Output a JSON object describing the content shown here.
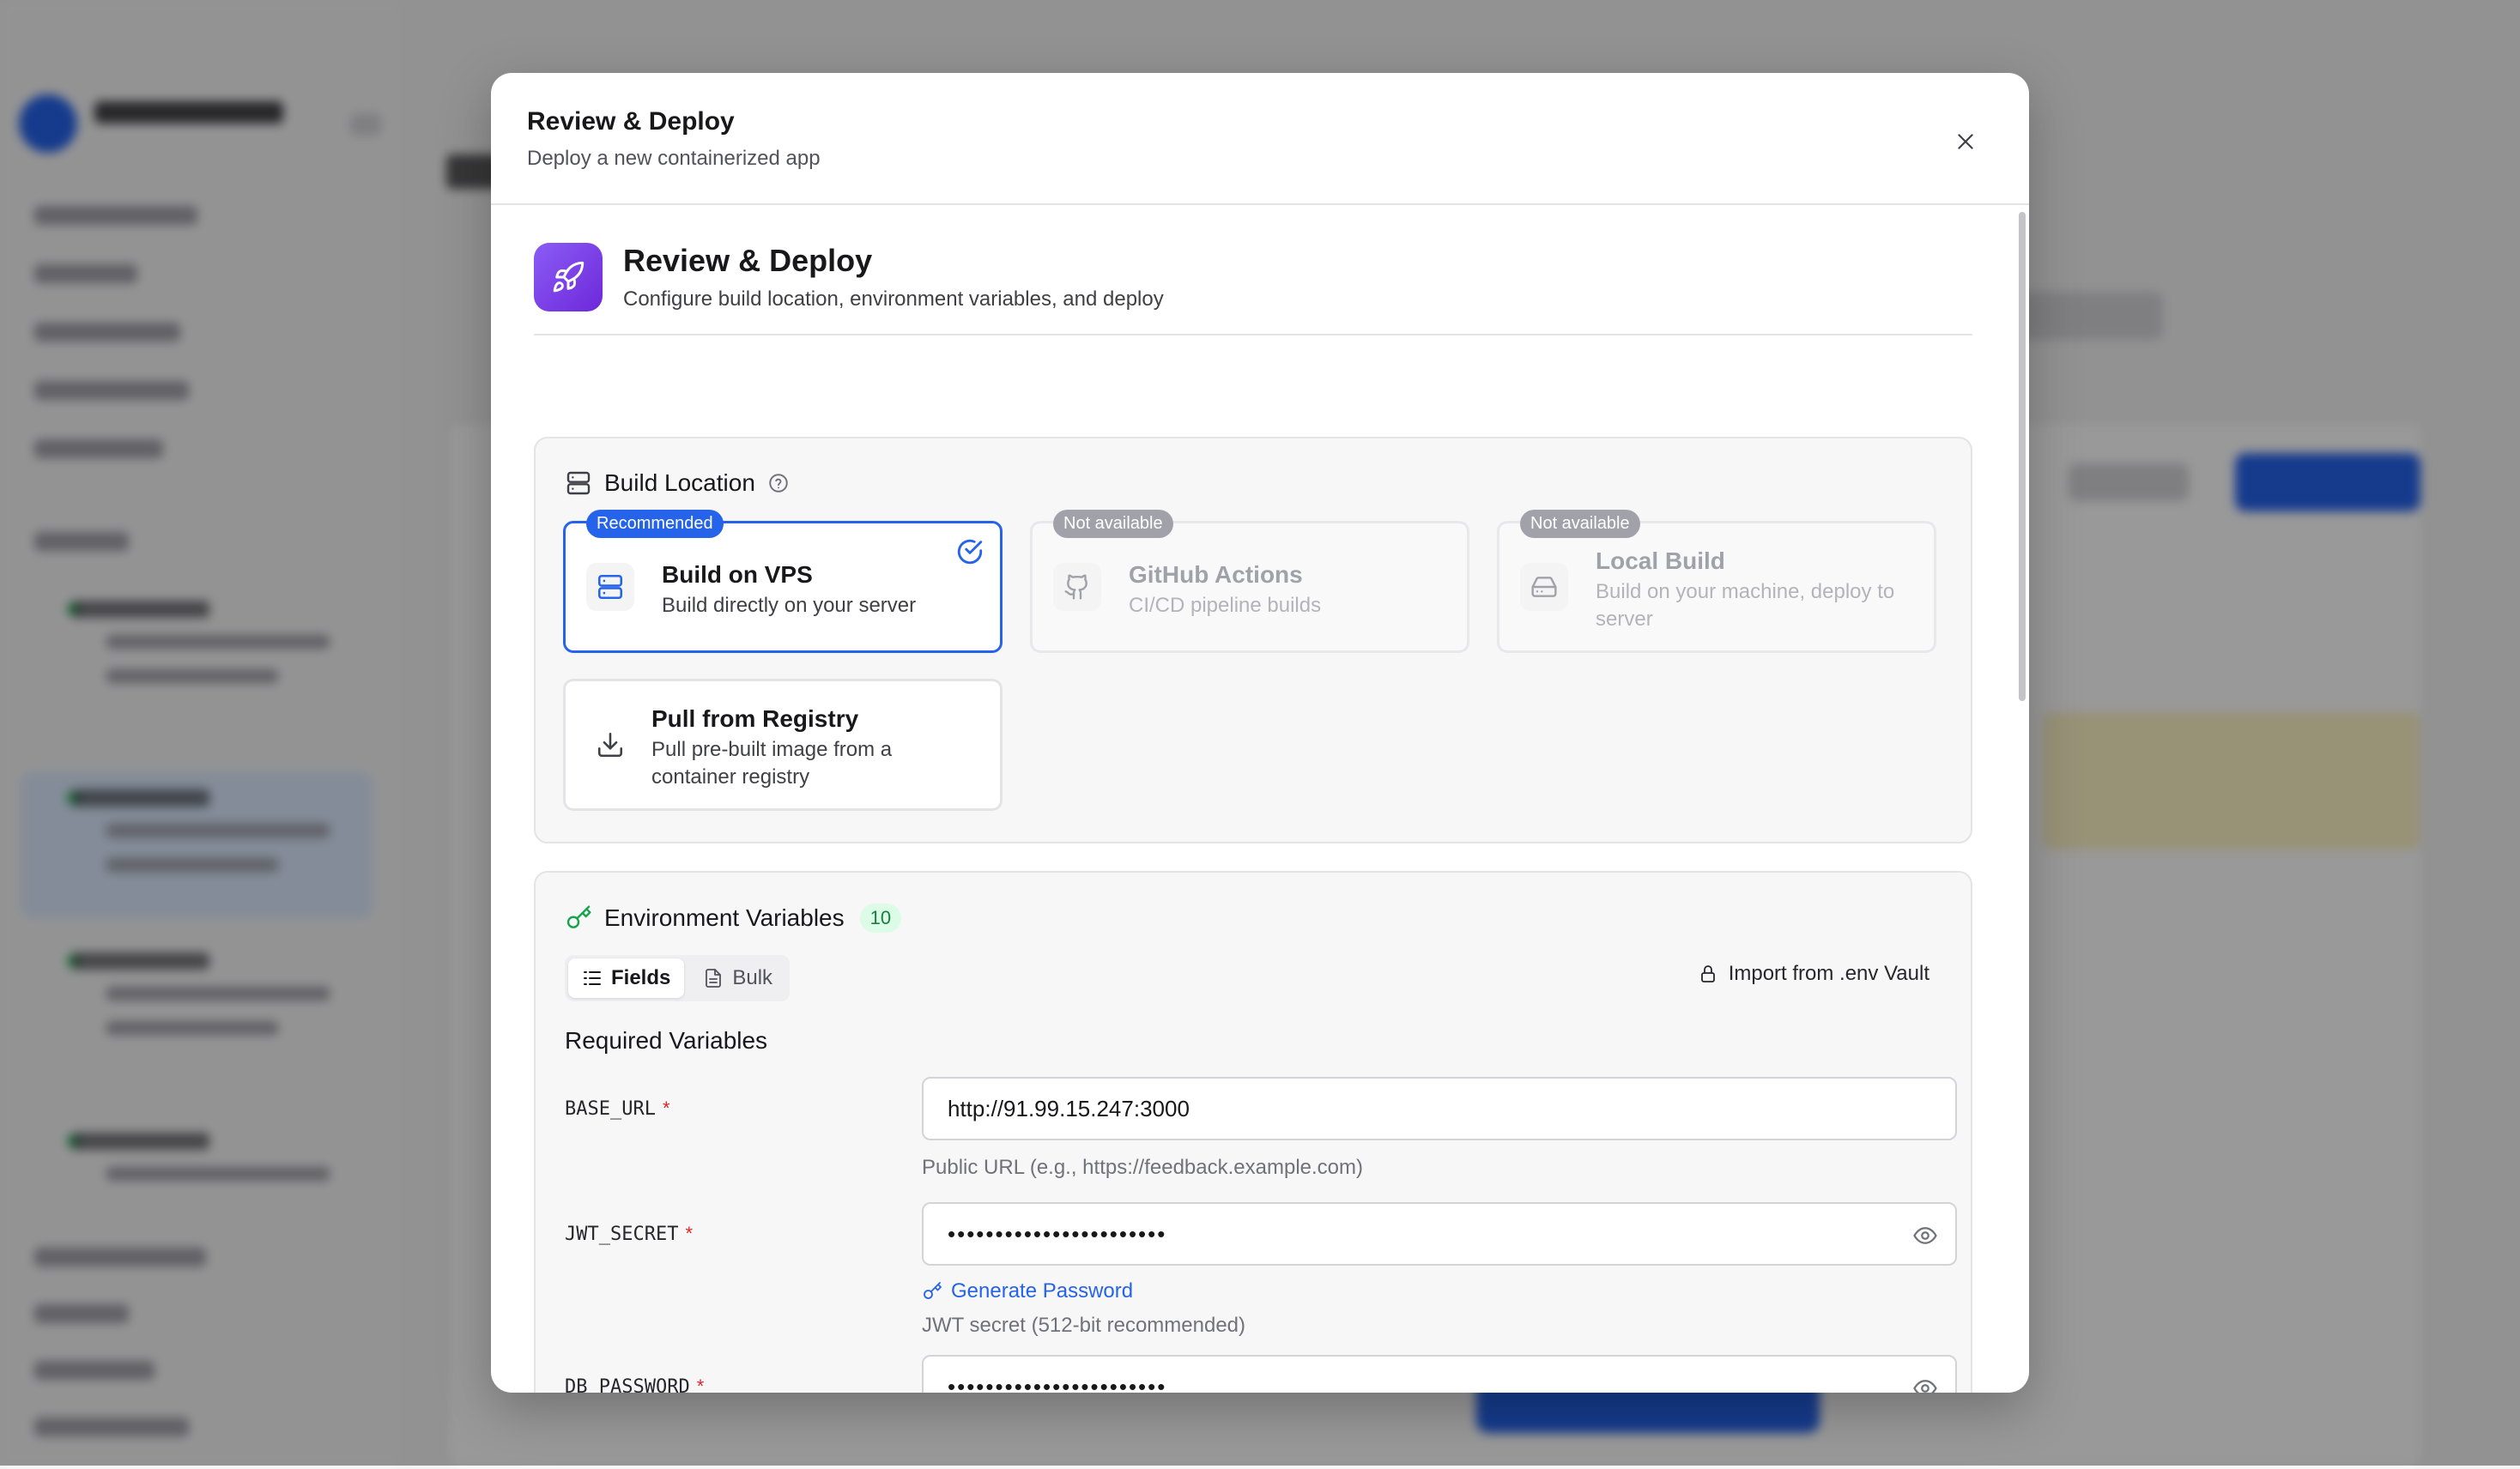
{
  "dialog": {
    "title": "Review & Deploy",
    "subtitle": "Deploy a new containerized app"
  },
  "step": {
    "icon": "rocket-icon",
    "title": "Review & Deploy",
    "subtitle": "Configure build location, environment variables, and deploy"
  },
  "build_location": {
    "title": "Build Location",
    "options": [
      {
        "badge": "Recommended",
        "title": "Build on VPS",
        "desc": "Build directly on your server",
        "icon": "server-icon",
        "selected": true,
        "available": true
      },
      {
        "badge": "Not available",
        "title": "GitHub Actions",
        "desc": "CI/CD pipeline builds",
        "icon": "github-icon",
        "selected": false,
        "available": false
      },
      {
        "badge": "Not available",
        "title": "Local Build",
        "desc": "Build on your machine, deploy to server",
        "icon": "hard-drive-icon",
        "selected": false,
        "available": false
      },
      {
        "badge": "",
        "title": "Pull from Registry",
        "desc": "Pull pre-built image from a container registry",
        "icon": "download-icon",
        "selected": false,
        "available": true
      }
    ]
  },
  "env": {
    "title": "Environment Variables",
    "count": "10",
    "tabs": [
      {
        "label": "Fields",
        "active": true
      },
      {
        "label": "Bulk",
        "active": false
      }
    ],
    "import_label": "Import from .env Vault",
    "required_title": "Required Variables",
    "generate_label": "Generate Password",
    "vars": [
      {
        "name": "BASE_URL",
        "value": "http://91.99.15.247:3000",
        "help": "Public URL (e.g., https://feedback.example.com)"
      },
      {
        "name": "JWT_SECRET",
        "value": "•••••••••••••••••••••••",
        "help": "JWT secret (512-bit recommended)"
      },
      {
        "name": "DB_PASSWORD",
        "value": "•••••••••••••••••••••••",
        "help": ""
      }
    ]
  },
  "colors": {
    "accent": "#2563eb",
    "required_star": "#dc2626",
    "count_badge_bg": "#dcfce7",
    "count_badge_fg": "#15803d",
    "step_icon_gradient": [
      "#8b5cf6",
      "#6d28d9"
    ],
    "overlay": "rgba(0,0,0,0.40)"
  }
}
